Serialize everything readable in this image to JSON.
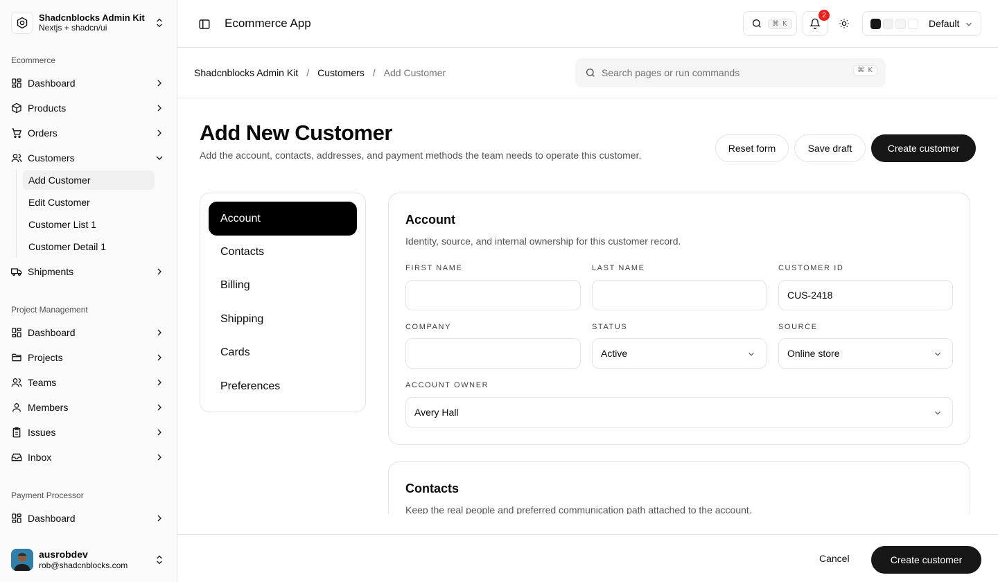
{
  "sidebar": {
    "brand": {
      "title": "Shadcnblocks Admin Kit",
      "subtitle": "Nextjs + shadcn/ui"
    },
    "sections": [
      {
        "label": "Ecommerce",
        "items": [
          {
            "label": "Dashboard",
            "icon": "dashboard-icon"
          },
          {
            "label": "Products",
            "icon": "package-icon"
          },
          {
            "label": "Orders",
            "icon": "cart-icon"
          },
          {
            "label": "Customers",
            "icon": "users-icon",
            "expanded": true,
            "children": [
              {
                "label": "Add Customer",
                "active": true
              },
              {
                "label": "Edit Customer"
              },
              {
                "label": "Customer List 1"
              },
              {
                "label": "Customer Detail 1"
              }
            ]
          },
          {
            "label": "Shipments",
            "icon": "truck-icon"
          }
        ]
      },
      {
        "label": "Project Management",
        "items": [
          {
            "label": "Dashboard",
            "icon": "dashboard-icon"
          },
          {
            "label": "Projects",
            "icon": "folder-icon"
          },
          {
            "label": "Teams",
            "icon": "users-icon"
          },
          {
            "label": "Members",
            "icon": "user-icon"
          },
          {
            "label": "Issues",
            "icon": "clipboard-icon"
          },
          {
            "label": "Inbox",
            "icon": "inbox-icon"
          }
        ]
      },
      {
        "label": "Payment Processor",
        "items": [
          {
            "label": "Dashboard",
            "icon": "dashboard-icon"
          }
        ]
      }
    ],
    "user": {
      "name": "ausrobdev",
      "email": "rob@shadcnblocks.com"
    }
  },
  "header": {
    "app_title": "Ecommerce App",
    "search_shortcut": "⌘ K",
    "notifications_count": "2",
    "palette": {
      "label": "Default",
      "swatches": [
        "#171717",
        "#f0f0f0",
        "#f5f5f5",
        "#ffffff"
      ]
    }
  },
  "breadcrumb": {
    "items": [
      "Shadcnblocks Admin Kit",
      "Customers"
    ],
    "current": "Add Customer",
    "separator": "/"
  },
  "command_search": {
    "placeholder": "Search pages or run commands",
    "shortcut": "⌘ K"
  },
  "page": {
    "title": "Add New Customer",
    "description": "Add the account, contacts, addresses, and payment methods the team needs to operate this customer.",
    "actions": {
      "reset": "Reset form",
      "save_draft": "Save draft",
      "create": "Create customer"
    }
  },
  "section_nav": [
    "Account",
    "Contacts",
    "Billing",
    "Shipping",
    "Cards",
    "Preferences"
  ],
  "account_card": {
    "title": "Account",
    "description": "Identity, source, and internal ownership for this customer record.",
    "fields": {
      "first_name": {
        "label": "FIRST NAME",
        "value": ""
      },
      "last_name": {
        "label": "LAST NAME",
        "value": ""
      },
      "customer_id": {
        "label": "CUSTOMER ID",
        "value": "CUS-2418"
      },
      "company": {
        "label": "COMPANY",
        "value": ""
      },
      "status": {
        "label": "STATUS",
        "value": "Active"
      },
      "source": {
        "label": "SOURCE",
        "value": "Online store"
      },
      "account_owner": {
        "label": "ACCOUNT OWNER",
        "value": "Avery Hall"
      }
    }
  },
  "contacts_card": {
    "title": "Contacts",
    "description": "Keep the real people and preferred communication path attached to the account."
  },
  "footer": {
    "cancel": "Cancel",
    "create": "Create customer"
  },
  "colors": {
    "accent": "#171717",
    "badge": "#ef1c1c",
    "border": "#e5e5e5",
    "muted_text": "#737373"
  }
}
